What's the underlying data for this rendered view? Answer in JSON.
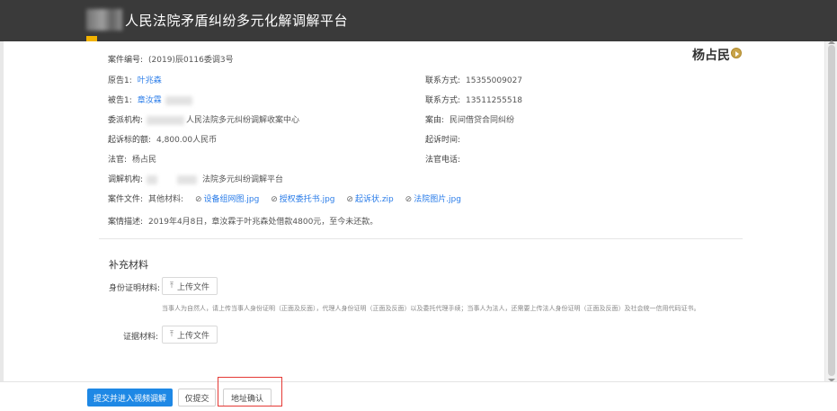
{
  "header": {
    "title": "人民法院矛盾纠纷多元化解调解平台"
  },
  "case": {
    "judge_name": "杨占民",
    "number": {
      "label": "案件编号:",
      "value": "(2019)辰0116委调3号"
    },
    "plaintiff": {
      "label": "原告1:",
      "value": "叶兆森"
    },
    "plaintiff_contact": {
      "label": "联系方式:",
      "value": "15355009027"
    },
    "defendant": {
      "label": "被告1:",
      "value": "章汝霖"
    },
    "defendant_contact": {
      "label": "联系方式:",
      "value": "13511255518"
    },
    "agency": {
      "label": "委派机构:",
      "value": "人民法院多元纠纷调解收案中心"
    },
    "cause": {
      "label": "案由:",
      "value": "民间借贷合同纠纷"
    },
    "amount": {
      "label": "起诉标的额:",
      "value": "4,800.00人民币"
    },
    "filing_time": {
      "label": "起诉时间:",
      "value": ""
    },
    "judge": {
      "label": "法官:",
      "value": "杨占民"
    },
    "judge_phone": {
      "label": "法官电话:",
      "value": ""
    },
    "mediator": {
      "label": "调解机构:",
      "value": "法院多元纠纷调解平台"
    },
    "files": {
      "label": "案件文件:",
      "sub_label": "其他材料:",
      "items": [
        "设备组网图.jpg",
        "授权委托书.jpg",
        "起诉状.zip",
        "法院图片.jpg"
      ]
    },
    "description": {
      "label": "案情描述:",
      "value": "2019年4月8日，章汝霖于叶兆森处借款4800元，至今未还款。"
    }
  },
  "supplement": {
    "title": "补充材料",
    "identity_label": "身份证明材料:",
    "evidence_label": "证据材料:",
    "upload_label": "上传文件",
    "hint": "当事人为自然人，请上传当事人身份证明（正面及反面），代理人身份证明（正面及反面）以及委托代理手续；当事人为法人，还需要上传法人身份证明（正面及反面）及社会统一信用代码证书。"
  },
  "footer": {
    "submit_video": "提交并进入视频调解",
    "submit_only": "仅提交",
    "address_confirm": "地址确认"
  },
  "colors": {
    "header_bg": "#3a3a3a",
    "primary": "#1e88e5",
    "link": "#2b7de9",
    "highlight": "#e53935"
  }
}
